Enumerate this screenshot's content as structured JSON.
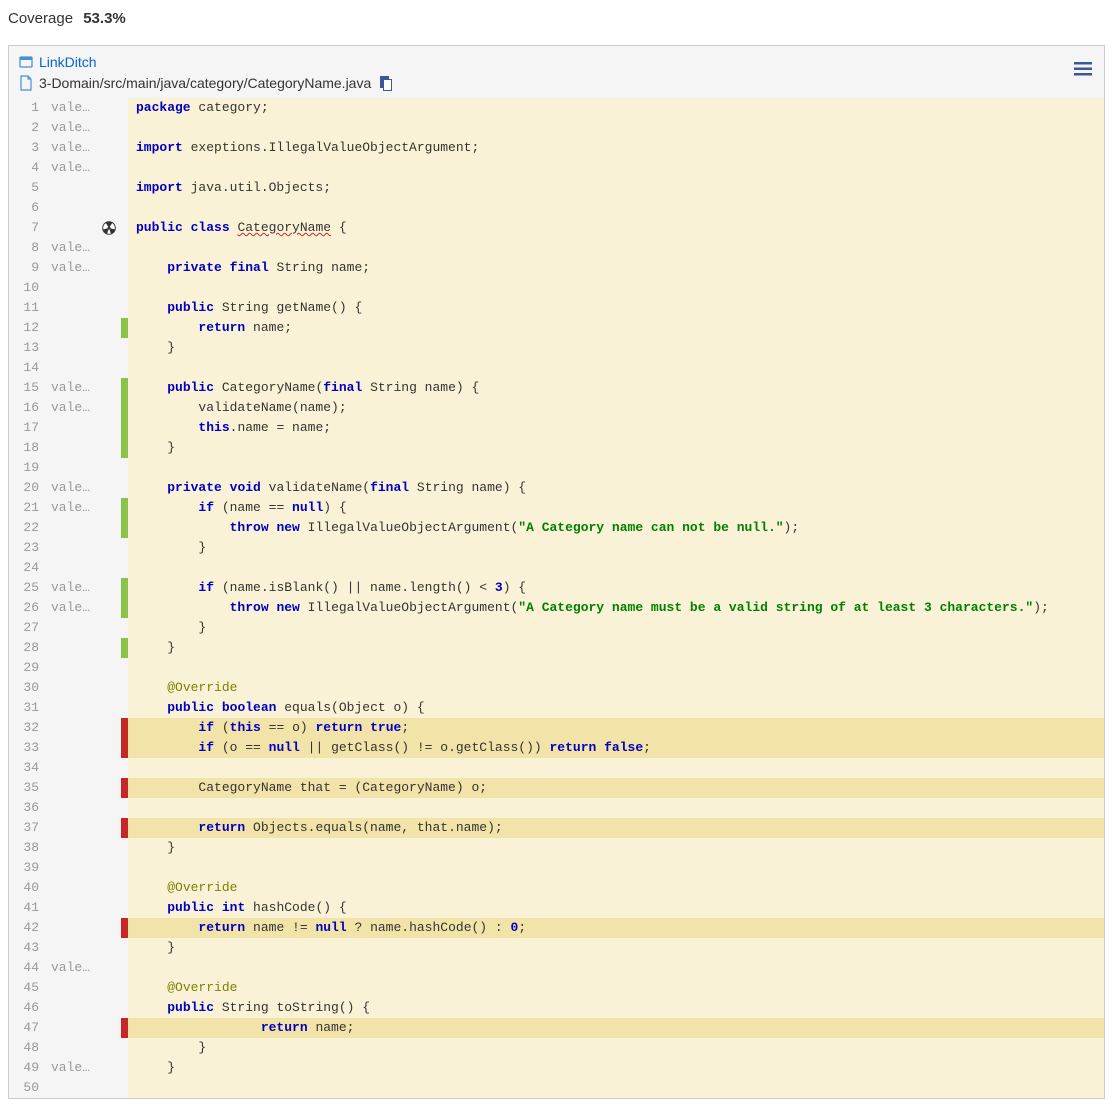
{
  "header": {
    "label": "Coverage",
    "value": "53.3%"
  },
  "breadcrumbs": {
    "root_link": "LinkDitch",
    "file_path": "3-Domain/src/main/java/category/CategoryName.java"
  },
  "author_blame": "vale…",
  "lines": [
    {
      "n": 1,
      "author": true,
      "cov": "none",
      "hl": false,
      "tokens": [
        [
          "kw",
          "package"
        ],
        [
          "p",
          " category;"
        ]
      ]
    },
    {
      "n": 2,
      "author": true,
      "cov": "none",
      "hl": false,
      "tokens": []
    },
    {
      "n": 3,
      "author": true,
      "cov": "none",
      "hl": false,
      "tokens": [
        [
          "kw",
          "import"
        ],
        [
          "p",
          " exeptions.IllegalValueObjectArgument;"
        ]
      ]
    },
    {
      "n": 4,
      "author": true,
      "cov": "none",
      "hl": false,
      "tokens": []
    },
    {
      "n": 5,
      "author": false,
      "cov": "none",
      "hl": false,
      "tokens": [
        [
          "kw",
          "import"
        ],
        [
          "p",
          " java.util.Objects;"
        ]
      ]
    },
    {
      "n": 6,
      "author": false,
      "cov": "none",
      "hl": false,
      "tokens": []
    },
    {
      "n": 7,
      "author": false,
      "cov": "none",
      "hl": false,
      "marker": "radiation",
      "tokens": [
        [
          "kw",
          "public"
        ],
        [
          "p",
          " "
        ],
        [
          "kw",
          "class"
        ],
        [
          "p",
          " "
        ],
        [
          "wavy",
          "CategoryName"
        ],
        [
          "p",
          " {"
        ]
      ]
    },
    {
      "n": 8,
      "author": true,
      "cov": "none",
      "hl": false,
      "tokens": []
    },
    {
      "n": 9,
      "author": true,
      "cov": "none",
      "hl": false,
      "tokens": [
        [
          "p",
          "    "
        ],
        [
          "kw",
          "private"
        ],
        [
          "p",
          " "
        ],
        [
          "kw",
          "final"
        ],
        [
          "p",
          " String name;"
        ]
      ]
    },
    {
      "n": 10,
      "author": false,
      "cov": "none",
      "hl": false,
      "tokens": []
    },
    {
      "n": 11,
      "author": false,
      "cov": "none",
      "hl": false,
      "tokens": [
        [
          "p",
          "    "
        ],
        [
          "kw",
          "public"
        ],
        [
          "p",
          " String getName() {"
        ]
      ]
    },
    {
      "n": 12,
      "author": false,
      "cov": "green",
      "hl": false,
      "tokens": [
        [
          "p",
          "        "
        ],
        [
          "kw",
          "return"
        ],
        [
          "p",
          " name;"
        ]
      ]
    },
    {
      "n": 13,
      "author": false,
      "cov": "none",
      "hl": false,
      "tokens": [
        [
          "p",
          "    }"
        ]
      ]
    },
    {
      "n": 14,
      "author": false,
      "cov": "none",
      "hl": false,
      "tokens": []
    },
    {
      "n": 15,
      "author": true,
      "cov": "green",
      "hl": false,
      "tokens": [
        [
          "p",
          "    "
        ],
        [
          "kw",
          "public"
        ],
        [
          "p",
          " CategoryName("
        ],
        [
          "kw",
          "final"
        ],
        [
          "p",
          " String name) {"
        ]
      ]
    },
    {
      "n": 16,
      "author": true,
      "cov": "green",
      "hl": false,
      "tokens": [
        [
          "p",
          "        validateName(name);"
        ]
      ]
    },
    {
      "n": 17,
      "author": false,
      "cov": "green",
      "hl": false,
      "tokens": [
        [
          "p",
          "        "
        ],
        [
          "kw",
          "this"
        ],
        [
          "p",
          ".name = name;"
        ]
      ]
    },
    {
      "n": 18,
      "author": false,
      "cov": "green",
      "hl": false,
      "tokens": [
        [
          "p",
          "    }"
        ]
      ]
    },
    {
      "n": 19,
      "author": false,
      "cov": "none",
      "hl": false,
      "tokens": []
    },
    {
      "n": 20,
      "author": true,
      "cov": "none",
      "hl": false,
      "tokens": [
        [
          "p",
          "    "
        ],
        [
          "kw",
          "private"
        ],
        [
          "p",
          " "
        ],
        [
          "kw",
          "void"
        ],
        [
          "p",
          " validateName("
        ],
        [
          "kw",
          "final"
        ],
        [
          "p",
          " String name) {"
        ]
      ]
    },
    {
      "n": 21,
      "author": true,
      "cov": "green",
      "hl": false,
      "tokens": [
        [
          "p",
          "        "
        ],
        [
          "kw",
          "if"
        ],
        [
          "p",
          " (name == "
        ],
        [
          "kw",
          "null"
        ],
        [
          "p",
          ") {"
        ]
      ]
    },
    {
      "n": 22,
      "author": false,
      "cov": "green",
      "hl": false,
      "tokens": [
        [
          "p",
          "            "
        ],
        [
          "kw",
          "throw"
        ],
        [
          "p",
          " "
        ],
        [
          "kw",
          "new"
        ],
        [
          "p",
          " IllegalValueObjectArgument("
        ],
        [
          "str",
          "\"A Category name can not be null.\""
        ],
        [
          "p",
          ");"
        ]
      ]
    },
    {
      "n": 23,
      "author": false,
      "cov": "none",
      "hl": false,
      "tokens": [
        [
          "p",
          "        }"
        ]
      ]
    },
    {
      "n": 24,
      "author": false,
      "cov": "none",
      "hl": false,
      "tokens": []
    },
    {
      "n": 25,
      "author": true,
      "cov": "green",
      "hl": false,
      "tokens": [
        [
          "p",
          "        "
        ],
        [
          "kw",
          "if"
        ],
        [
          "p",
          " (name.isBlank() || name.length() < "
        ],
        [
          "num",
          "3"
        ],
        [
          "p",
          ") {"
        ]
      ]
    },
    {
      "n": 26,
      "author": true,
      "cov": "green",
      "hl": false,
      "tokens": [
        [
          "p",
          "            "
        ],
        [
          "kw",
          "throw"
        ],
        [
          "p",
          " "
        ],
        [
          "kw",
          "new"
        ],
        [
          "p",
          " IllegalValueObjectArgument("
        ],
        [
          "str",
          "\"A Category name must be a valid string of at least 3 characters.\""
        ],
        [
          "p",
          ");"
        ]
      ]
    },
    {
      "n": 27,
      "author": false,
      "cov": "none",
      "hl": false,
      "tokens": [
        [
          "p",
          "        }"
        ]
      ]
    },
    {
      "n": 28,
      "author": false,
      "cov": "green",
      "hl": false,
      "tokens": [
        [
          "p",
          "    }"
        ]
      ]
    },
    {
      "n": 29,
      "author": false,
      "cov": "none",
      "hl": false,
      "tokens": []
    },
    {
      "n": 30,
      "author": false,
      "cov": "none",
      "hl": false,
      "tokens": [
        [
          "p",
          "    "
        ],
        [
          "ann",
          "@Override"
        ]
      ]
    },
    {
      "n": 31,
      "author": false,
      "cov": "none",
      "hl": false,
      "tokens": [
        [
          "p",
          "    "
        ],
        [
          "kw",
          "public"
        ],
        [
          "p",
          " "
        ],
        [
          "kw",
          "boolean"
        ],
        [
          "p",
          " equals(Object o) {"
        ]
      ]
    },
    {
      "n": 32,
      "author": false,
      "cov": "red",
      "hl": true,
      "tokens": [
        [
          "p",
          "        "
        ],
        [
          "kw",
          "if"
        ],
        [
          "p",
          " ("
        ],
        [
          "kw",
          "this"
        ],
        [
          "p",
          " == o) "
        ],
        [
          "kw",
          "return"
        ],
        [
          "p",
          " "
        ],
        [
          "kw",
          "true"
        ],
        [
          "p",
          ";"
        ]
      ]
    },
    {
      "n": 33,
      "author": false,
      "cov": "red",
      "hl": true,
      "tokens": [
        [
          "p",
          "        "
        ],
        [
          "kw",
          "if"
        ],
        [
          "p",
          " (o == "
        ],
        [
          "kw",
          "null"
        ],
        [
          "p",
          " || getClass() != o.getClass()) "
        ],
        [
          "kw",
          "return"
        ],
        [
          "p",
          " "
        ],
        [
          "kw",
          "false"
        ],
        [
          "p",
          ";"
        ]
      ]
    },
    {
      "n": 34,
      "author": false,
      "cov": "none",
      "hl": false,
      "tokens": []
    },
    {
      "n": 35,
      "author": false,
      "cov": "red",
      "hl": true,
      "tokens": [
        [
          "p",
          "        CategoryName that = (CategoryName) o;"
        ]
      ]
    },
    {
      "n": 36,
      "author": false,
      "cov": "none",
      "hl": false,
      "tokens": []
    },
    {
      "n": 37,
      "author": false,
      "cov": "red",
      "hl": true,
      "tokens": [
        [
          "p",
          "        "
        ],
        [
          "kw",
          "return"
        ],
        [
          "p",
          " Objects.equals(name, that.name);"
        ]
      ]
    },
    {
      "n": 38,
      "author": false,
      "cov": "none",
      "hl": false,
      "tokens": [
        [
          "p",
          "    }"
        ]
      ]
    },
    {
      "n": 39,
      "author": false,
      "cov": "none",
      "hl": false,
      "tokens": []
    },
    {
      "n": 40,
      "author": false,
      "cov": "none",
      "hl": false,
      "tokens": [
        [
          "p",
          "    "
        ],
        [
          "ann",
          "@Override"
        ]
      ]
    },
    {
      "n": 41,
      "author": false,
      "cov": "none",
      "hl": false,
      "tokens": [
        [
          "p",
          "    "
        ],
        [
          "kw",
          "public"
        ],
        [
          "p",
          " "
        ],
        [
          "kw",
          "int"
        ],
        [
          "p",
          " hashCode() {"
        ]
      ]
    },
    {
      "n": 42,
      "author": false,
      "cov": "red",
      "hl": true,
      "tokens": [
        [
          "p",
          "        "
        ],
        [
          "kw",
          "return"
        ],
        [
          "p",
          " name != "
        ],
        [
          "kw",
          "null"
        ],
        [
          "p",
          " ? name.hashCode() : "
        ],
        [
          "num",
          "0"
        ],
        [
          "p",
          ";"
        ]
      ]
    },
    {
      "n": 43,
      "author": false,
      "cov": "none",
      "hl": false,
      "tokens": [
        [
          "p",
          "    }"
        ]
      ]
    },
    {
      "n": 44,
      "author": true,
      "cov": "none",
      "hl": false,
      "tokens": []
    },
    {
      "n": 45,
      "author": false,
      "cov": "none",
      "hl": false,
      "tokens": [
        [
          "p",
          "    "
        ],
        [
          "ann",
          "@Override"
        ]
      ]
    },
    {
      "n": 46,
      "author": false,
      "cov": "none",
      "hl": false,
      "tokens": [
        [
          "p",
          "    "
        ],
        [
          "kw",
          "public"
        ],
        [
          "p",
          " String toString() {"
        ]
      ]
    },
    {
      "n": 47,
      "author": false,
      "cov": "red",
      "hl": true,
      "tokens": [
        [
          "p",
          "                "
        ],
        [
          "kw",
          "return"
        ],
        [
          "p",
          " name;"
        ]
      ]
    },
    {
      "n": 48,
      "author": false,
      "cov": "none",
      "hl": false,
      "tokens": [
        [
          "p",
          "        }"
        ]
      ]
    },
    {
      "n": 49,
      "author": true,
      "cov": "none",
      "hl": false,
      "tokens": [
        [
          "p",
          "    }"
        ]
      ]
    },
    {
      "n": 50,
      "author": false,
      "cov": "none",
      "hl": false,
      "tokens": []
    }
  ]
}
